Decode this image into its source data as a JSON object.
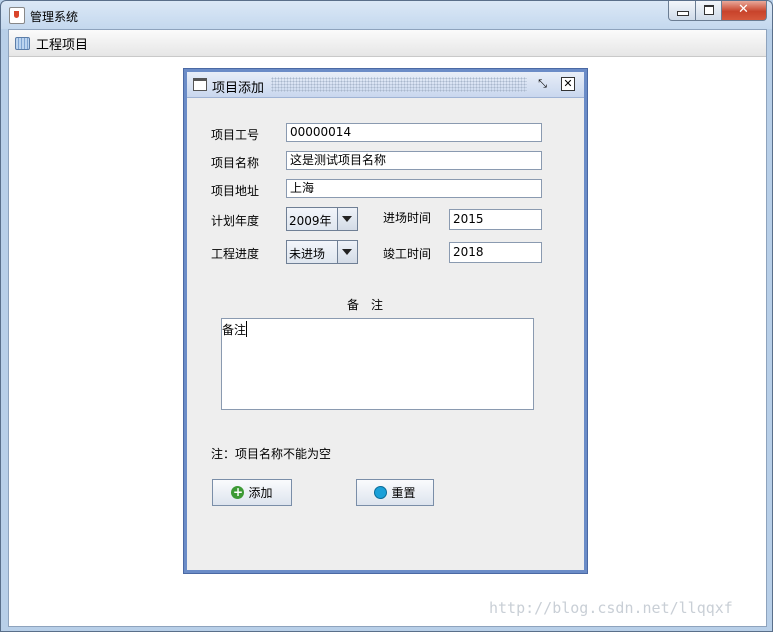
{
  "window": {
    "title": "管理系统",
    "close_glyph": "✕"
  },
  "menubar": {
    "items": [
      {
        "label": "工程项目",
        "icon": "folder-list-icon"
      }
    ]
  },
  "internal_frame": {
    "title": "项目添加",
    "restore_glyph": "⤡",
    "close_glyph": "✕",
    "form": {
      "project_no_label": "项目工号",
      "project_no_value": "00000014",
      "project_name_label": "项目名称",
      "project_name_value": "这是测试项目名称",
      "project_address_label": "项目地址",
      "project_address_value": "上海",
      "plan_year_label": "计划年度",
      "plan_year_value": "2009年",
      "entry_time_label": "进场时间",
      "entry_time_value": "2015",
      "progress_label": "工程进度",
      "progress_value": "未进场",
      "completion_time_label": "竣工时间",
      "completion_time_value": "2018",
      "remark_label": "备　注",
      "remark_value": "备注",
      "note": "注：项目名称不能为空"
    },
    "buttons": {
      "add_label": "添加",
      "add_glyph": "+",
      "reset_label": "重置"
    }
  },
  "watermark": "http://blog.csdn.net/llqqxf"
}
